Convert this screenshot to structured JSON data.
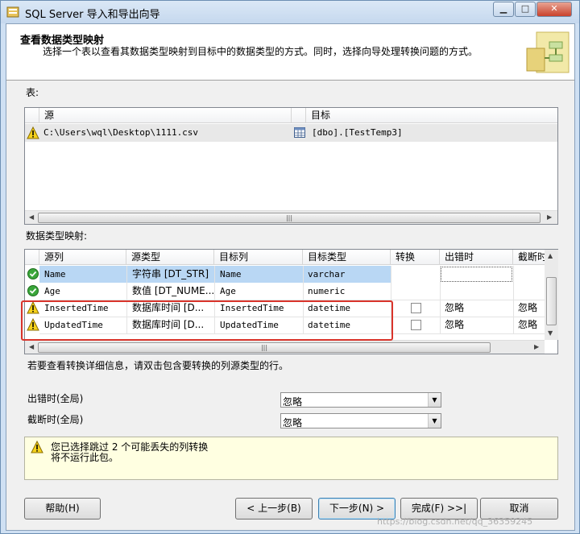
{
  "window": {
    "title": "SQL Server 导入和导出向导"
  },
  "header": {
    "title": "查看数据类型映射",
    "description": "选择一个表以查看其数据类型映射到目标中的数据类型的方式。同时，选择向导处理转换问题的方式。"
  },
  "tables_section": {
    "label": "表:",
    "columns": [
      "源",
      "目标"
    ],
    "rows": [
      {
        "source": "C:\\Users\\wql\\Desktop\\1111.csv",
        "target": "[dbo].[TestTemp3]",
        "status_icon": "warning-icon"
      }
    ]
  },
  "mapping_section": {
    "label": "数据类型映射:",
    "columns": [
      "源列",
      "源类型",
      "目标列",
      "目标类型",
      "转换",
      "出错时",
      "截断时"
    ],
    "rows": [
      {
        "status_icon": "check-icon",
        "source_col": "Name",
        "source_type": "字符串 [DT_STR]",
        "target_col": "Name",
        "target_type": "varchar",
        "convert": false,
        "on_error": "",
        "on_truncate": ""
      },
      {
        "status_icon": "check-icon",
        "source_col": "Age",
        "source_type": "数值 [DT_NUME...",
        "target_col": "Age",
        "target_type": "numeric",
        "convert": false,
        "on_error": "",
        "on_truncate": ""
      },
      {
        "status_icon": "warning-icon",
        "source_col": "InsertedTime",
        "source_type": "数据库时间 [D...",
        "target_col": "InsertedTime",
        "target_type": "datetime",
        "convert": false,
        "on_error": "忽略",
        "on_truncate": "忽略"
      },
      {
        "status_icon": "warning-icon",
        "source_col": "UpdatedTime",
        "source_type": "数据库时间 [D...",
        "target_col": "UpdatedTime",
        "target_type": "datetime",
        "convert": false,
        "on_error": "忽略",
        "on_truncate": "忽略"
      }
    ]
  },
  "hint": "若要查看转换详细信息，请双击包含要转换的列源类型的行。",
  "global_options": {
    "on_error_label": "出错时(全局)",
    "on_error_value": "忽略",
    "on_truncate_label": "截断时(全局)",
    "on_truncate_value": "忽略"
  },
  "message": {
    "line1": "您已选择跳过 2 个可能丢失的列转换",
    "line2": "将不运行此包。"
  },
  "buttons": {
    "help": "帮助(H)",
    "back": "< 上一步(B)",
    "next": "下一步(N) >",
    "finish": "完成(F) >>|",
    "cancel": "取消"
  },
  "watermark": "https://blog.csdn.net/qq_36359245"
}
